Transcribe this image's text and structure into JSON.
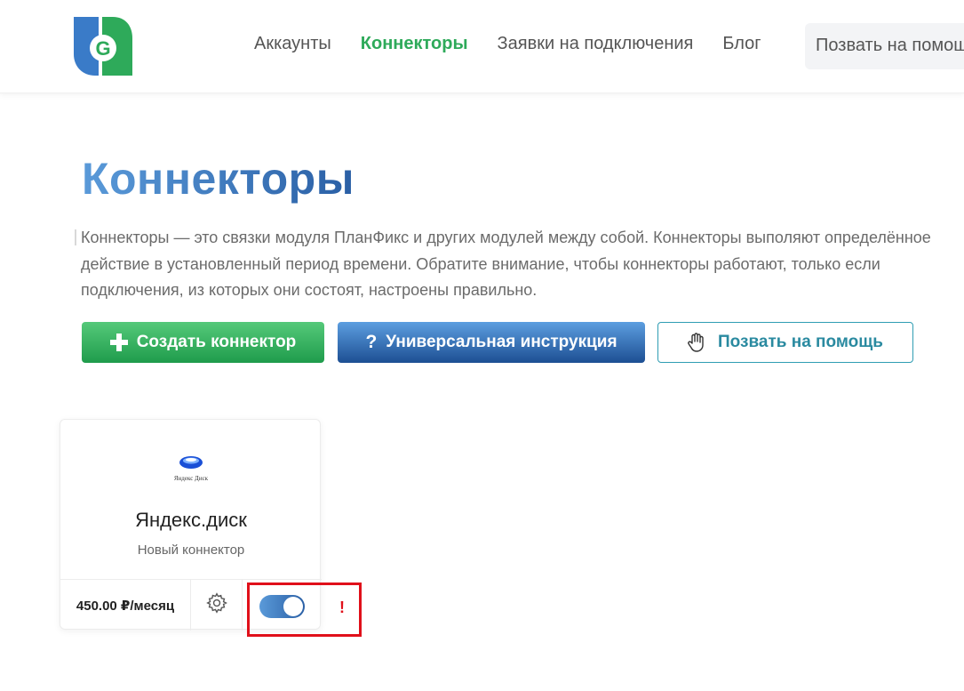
{
  "header": {
    "nav": [
      {
        "label": "Аккаунты",
        "active": false
      },
      {
        "label": "Коннекторы",
        "active": true
      },
      {
        "label": "Заявки на подключения",
        "active": false
      },
      {
        "label": "Блог",
        "active": false
      }
    ],
    "help_label": "Позвать на помощь"
  },
  "main": {
    "title": "Коннекторы",
    "intro": "Коннекторы — это связки модуля ПланФикс и других модулей между собой. Коннекторы выполяют определённое действие в установленный период времени. Обратите внимание, чтобы коннекторы работают, только если подключения, из которых они состоят, настроены правильно.",
    "buttons": {
      "create": "Создать коннектор",
      "guide": "Универсальная инструкция",
      "help": "Позвать на помощь"
    }
  },
  "connector": {
    "logo_caption": "Яндекс Диск",
    "title": "Яндекс.диск",
    "subtitle": "Новый коннектор",
    "price": "450.00 ₽/месяц",
    "enabled": true,
    "warning": "!"
  },
  "colors": {
    "accent_green": "#2eaa5a",
    "accent_blue": "#2a5fa5",
    "highlight_red": "#e0101a"
  }
}
